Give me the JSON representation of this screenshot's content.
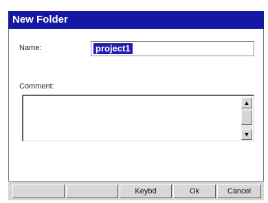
{
  "dialog": {
    "title": "New Folder",
    "title_color": "#1717a6"
  },
  "form": {
    "name_label": "Name:",
    "name_value": "project1",
    "comment_label": "Comment:",
    "comment_value": ""
  },
  "scrollbar": {
    "up_icon": "arrow-up-icon",
    "down_icon": "arrow-down-icon"
  },
  "buttons": {
    "blank1_label": "",
    "blank2_label": "",
    "keybd_label": "Keybd",
    "ok_label": "Ok",
    "cancel_label": "Cancel"
  }
}
